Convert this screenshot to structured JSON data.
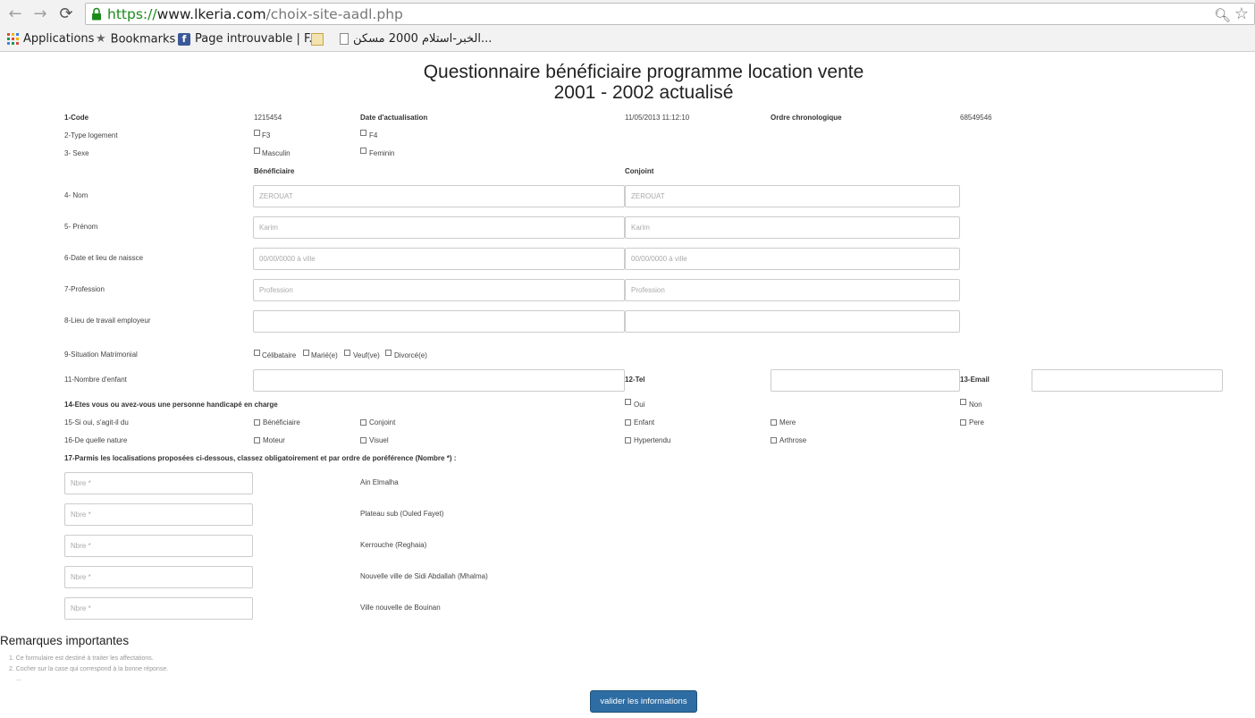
{
  "browser": {
    "url_scheme": "https://",
    "url_host": "www.lkeria.com",
    "url_path": "/choix-site-aadl.php",
    "bookmarks": {
      "apps": "Applications",
      "bookmarks": "Bookmarks",
      "facebook": "Page introuvable | F...",
      "arabic": "الخبر-استلام 2000 مسكن..."
    }
  },
  "form": {
    "title_line1": "Questionnaire bénéficiaire programme location vente",
    "title_line2": "2001 - 2002 actualisé",
    "code_label": "1-Code",
    "code_value": "1215454",
    "date_label": "Date d'actualisation",
    "date_value": "11/05/2013 11:12:10",
    "ordre_label": "Ordre chronologique",
    "ordre_value": "68549546",
    "type_logement_label": "2-Type logement",
    "f3": "F3",
    "f4": "F4",
    "sexe_label": "3- Sexe",
    "masculin": "Masculin",
    "feminin": "Feminin",
    "beneficiaire_header": "Bénéficiaire",
    "conjoint_header": "Conjoint",
    "nom_label": "4- Nom",
    "nom_placeholder": "ZEROUAT",
    "prenom_label": "5- Prénom",
    "prenom_placeholder": "Karim",
    "naissance_label": "6-Date et lieu de naissce",
    "naissance_placeholder": "00/00/0000 à ville",
    "profession_label": "7-Profession",
    "profession_placeholder": "Profession",
    "lieu_travail_label": "8-Lieu de travail employeur",
    "situation_label": "9-Situation Matrimonial",
    "celibataire": "Célibataire",
    "marie": "Marié(e)",
    "veuf": "Veuf(ve)",
    "divorce": "Divorcé(e)",
    "enfants_label": "11-Nombre d'enfant",
    "tel_label": "12-Tel",
    "email_label": "13-Email",
    "handicap_label": "14-Etes vous ou avez-vous une personne handicapé en charge",
    "oui": "Oui",
    "non": "Non",
    "sagit_label": "15-Si oui, s'agit-il du",
    "opt_beneficiaire": "Bénéficiaire",
    "opt_conjoint": "Conjoint",
    "opt_enfant": "Enfant",
    "opt_mere": "Mere",
    "opt_pere": "Pere",
    "nature_label": "16-De quelle nature",
    "opt_moteur": "Moteur",
    "opt_visuel": "Visuel",
    "opt_hypertendu": "Hypertendu",
    "opt_arthrose": "Arthrose",
    "localisations_label": "17-Parmis les localisations proposées ci-dessous, classez obligatoirement et par ordre de poréférence (Nombre *) :",
    "nbre_placeholder": "Nbre *",
    "sites": [
      "Ain Elmalha",
      "Plateau sub (Ouled Fayet)",
      "Kerrouche (Reghaia)",
      "Nouvelle ville de Sidi Abdallah (Mhalma)",
      "Ville nouvelle de Bouinan"
    ]
  },
  "remarks": {
    "title": "Remarques importantes",
    "item1": "1.   Ce formulaire est destiné à traiter les affectations.",
    "item2": "2.   Cocher sur la case qui correspond à la bonne réponse.",
    "item3": "..."
  },
  "submit_label": "valider les informations",
  "colors": {
    "button": "#2e6da4",
    "input_border": "#cccccc",
    "url_green": "#1a8a1a"
  }
}
